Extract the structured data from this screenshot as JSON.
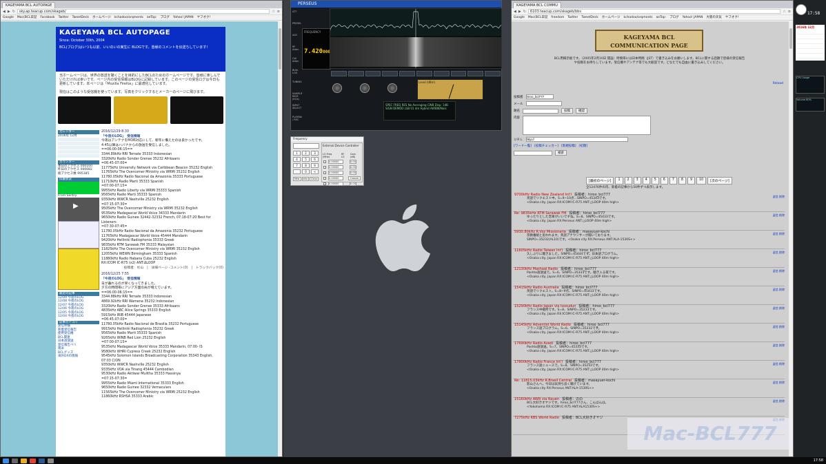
{
  "left_window": {
    "tab_title": "KAGEYAMA BCL AUTOPAGE",
    "url": "sky.ap.teacup.com/skageb/",
    "bookmarks": [
      "Google",
      "Mac(BCL日記",
      "Facebook",
      "Twitter",
      "TweetDeck",
      "ホームページ",
      "kchadoo/orqments",
      "aeTop:",
      "ブログ",
      "Yahoo! JAPAN",
      "ヤフオク!"
    ],
    "site_title": "KAGEYAMA BCL AUTOPAGE",
    "since": "Since: October 30th, 2004",
    "tagline": "BCL(ブログ)はいつも以前、いいのいの実生に BLOGです。皆様のコメントを伝送ちしています！",
    "intro": "当ホームページは、世界の放送を聴くことを目的にしたBCLのためのホームページです。皆様に楽しんでいただければ幸いです。ページ内の受信情報はBLOGに記録しています。このページの受信ログは今日も更新しています。本ページは「Mozilla Firefox」に最適化しています。",
    "radio_caption": "現在はこのような受信機を使っています。写真をクリックするとメーカーのページに飛びます。",
    "sidebar": {
      "calendar_title": "カレンダー",
      "calendar_month": "2016年 12月",
      "counter_title": "カウンター",
      "counter_lines": [
        "本日のアクセス 000160",
        "昨日のアクセス 000082",
        "総アクセス数 995385"
      ],
      "prop_title": "伝搬状況",
      "solar_title": "From:Sentry",
      "recent_title": "最近の記事",
      "recent_items": [
        "12/09 今夜のLOG",
        "12/08 今夜のLOG",
        "12/07 今夜のLOG",
        "12/06 今夜のLOG",
        "12/05 今夜のLOG",
        "12/04 今夜のLOG"
      ],
      "archive_title": "記事カテゴリ",
      "archive_items": [
        "受信体験",
        "新着受信報告",
        "使用受信機",
        "BCL関連",
        "日本語放送",
        "受信報告ベリ",
        "南米",
        "BCLグッズ",
        "海外DXの情報"
      ]
    },
    "posts": [
      {
        "date": "2016/12/29  8:33",
        "title": "「今夜のLOG」　受信情報",
        "lines": [
          "今夜はアンテナをMOR対応にして、新年に備えたのは良かったです。",
          "4:45以降はハバナからの放送を受信しました。",
          "==06:00-06:15==",
          "3344.89kHz RRI Ternate 35333 Indonesian",
          "3320kHz Radio Sonder Grense 35232 Afrikaans",
          "=06:45-07:00=",
          "11775kHz University Network via Caribbean Beacon 35232 English",
          "11765kHz The Overcomer Ministry via WRMI 35232 English",
          "11780.05kHz Radio Nacional da Amazonia 35333 Portuguese",
          "11710kHz Radio Marti 35333 Spanish",
          "=07:00-07:15=",
          "9955kHz Radio Liberty via WRMI 35333 Spanish",
          "9565kHz Radio Marti 35333 Spanish",
          "9350kHz WWCR Nashville 25232 English",
          "=07:15-07:30=",
          "9505kHz The Overcomer Ministry via WRMI 35232 English",
          "9535kHz Madagascar World Voice 34333 Mandarin",
          "9650kHz Radio Guinee 32442-32332 French, 07:18-07:20 Best for Listeners",
          "=07:30-07:45=",
          "11780.05kHz Radio Nacional da Amazonia 35232 Portuguese",
          "11765kHz Madagascar World Voice 45444 Mandarin",
          "9420kHz Hellinikí Radiophonia 35333 Greek",
          "9835kHz RTM Sarawak FM 35333 Malaysian",
          "11825kHz The Overcomer Ministry via WRMI 35232 English",
          "12055kHz WEWN Birmingham 35333 Spanish",
          "11880kHz Radio Habana Cuba 25232 English",
          "RX:ICOM IC-R75 (x2) ANT:ΔLOOP"
        ],
        "footer": "投稿者：杉山　|　詳細ページ -コメント(0)　|　トラックバック(0)"
      },
      {
        "date": "2016/12/25  7:55",
        "title": "「今夜のLOG」　受信情報",
        "lines": [
          "日が暮れるのが早くなってきました。",
          "夕方の時間帯にアジア方面の局が増えています。",
          "==06:00-06:15==",
          "3344.88kHz RRI Ternate 35333 Indonesian",
          "4869.92kHz RRI Wamena 35232 Indonesian",
          "3320kHz Radio Sonder Grense 35333 Afrikaans",
          "4835kHz ABC Alice Springs 35333 English",
          "5915kHz IRIB 45444 Japanese",
          "=06:45-07:00=",
          "11780.05kHz Radio Nacional de Brasilia 35232 Portuguese",
          "9915kHz Hellinikí Radiophonia 35232 Greek",
          "9565kHz Radio Marti 35333 Spanish",
          "9265kHz WINB Red Lion 25232 English",
          "=07:00-07:15=",
          "9535kHz Madagascar World Voice 35333 Mandarin, 07:00- IS",
          "9580kHz WHRI Cypress Creek 25232 English",
          "9545kHz Solomon Islands Broadcasting Corporation 35343 English, 07:03 C/ON",
          "9350kHz WWCR Nashville 25232 English",
          "9335kHz VOA via Tinang 45444 Cambodian",
          "9530kHz Radio Aktiwar Mulitha 35333 Hassinya",
          "=07:15-07:30=",
          "9955kHz Radio Miami International 35333 English",
          "9650kHz Radio Guinee 32332 Vernaculars",
          "11565kHz The Overcomer Ministry via WRMI 25232 English",
          "11860kHz RSHSA 35333 Arabic"
        ]
      }
    ]
  },
  "perseus": {
    "title": "PERSEUS",
    "frequency": "7.420",
    "frequency_small": "000",
    "freq_label": "FREQUENCY",
    "info_lines": [
      "SPEC FREQ RES No Averaging  CWB Disp: 1dB",
      "SIGN DEMOD LSB 01 4m Hybrid AtRBW/Nois"
    ],
    "meter_label": "Level (dBm)",
    "side_labels": [
      "ATT",
      "PRESEL",
      "AGC",
      "RF Atten",
      "CW Atten",
      "BUN-LOG",
      "TUNING",
      "SAMPLING RATE (kS/s)",
      "INPUT SELECT",
      "PLAYBACK / REC"
    ]
  },
  "ext_dialog": {
    "title": "External Device Controller",
    "left_title": "Frequency",
    "keys": [
      "1",
      "2",
      "3",
      "4",
      "5",
      "6",
      "7",
      "8",
      "9",
      ".",
      "0",
      "<"
    ],
    "bottom_keys": [
      "MHz",
      "kHz",
      "Clear"
    ],
    "headers": [
      "LO Freq (MHz)",
      "RF LO",
      "Gain (dB)"
    ],
    "rows": [
      "0.00000",
      "0.00000",
      "0.00000",
      "0.00000",
      "0.00000"
    ],
    "gain": [
      "0.00",
      "0.00",
      "0.00",
      "0.00",
      "0.00"
    ],
    "cancel": "Cancel"
  },
  "right_window": {
    "tab_title": "KAGEYAMA BCL COMMU",
    "url": "6103.teacup.com/skageb/bbs",
    "bookmarks": [
      "Google",
      "Mac(BCL日記",
      "freedom",
      "Twitter",
      "TweetDeck",
      "ホームページ",
      "kchadoo/orqments",
      "aeTop:",
      "ブログ",
      "Yahoo! JAPAN",
      "大阪の天気",
      "ヤフオク!"
    ],
    "site_title_1": "KAGEYAMA BCL",
    "site_title_2": "COMMUNICATION PAGE",
    "intro": "BCL用掲示板です。（2005年2月10日 開設）時間帯には日本時間（JST）で書き込みをお願いします。BCLに関する話題で皆様の受信報告や投稿をお待ちしています。受信機やアンテナ等でも大歓迎です。どなたでも自由に書き込みしてください。",
    "reload": "Reload",
    "form": {
      "name_label": "投稿者",
      "name_value": "hiroo_bcl777",
      "mail_label": "メール",
      "title_label": "題名",
      "content_label": "内容",
      "url_label": "ＵＲＬ",
      "url_value": "http://",
      "send_button": "投稿",
      "confirm_button": "確認",
      "search_button": "検索",
      "links": [
        "[ワード一覧]",
        "[投稿チェッカー]",
        "[新規投稿]",
        "[初期]"
      ]
    },
    "pages": [
      "[最初のページ]",
      "1",
      "2",
      "3",
      "4",
      "5",
      "6",
      "7",
      "8",
      "9",
      "10",
      "[次のページ]"
    ],
    "total": "全12476件の内、新着の記事から50件ずつ表示します。",
    "posts": [
      {
        "title": "9700kHz Radio New Zealand Int'l",
        "by": "投稿者：hiroo_bcl777",
        "body1": "英語でリクエスト中。S=9~10点…SINPO=45343です。",
        "body2": "<Osaka city, Japan RX:ICOM IC-R75 ANT:△LOOP 40m high>"
      },
      {
        "title": "Re: 9835kHz RTM Sarawak FM",
        "by": "投稿者：hiroo_bcl777",
        "body1": "ゆったりとした音楽がいいですね。S=8、SINPO=45433です。",
        "body2": "<Osaka city, Japan RX:Perseus ANT:△LOOP 40m high>"
      },
      {
        "title": "5930.80kHz R.Voz Missionaria",
        "by": "投稿者：masayuer-kochi",
        "body1": "宗教番組と思われます。英語アナウンサーが聞いております。",
        "body2": "SINPO=35232(AL10)です。<Osaka city RX:Perseus ANT:ALA-1530S+>"
      },
      {
        "title": "11605kHz Radio Taiwan Int'l",
        "by": "投稿者：hiroo_bcl777",
        "body1": "久しぶりに聴きました。SINPO=45444です。日本語プログラム。",
        "body2": "<Osaka city, Japan RX:ICOM IC-R75 ANT:△LOOP 40m high>"
      },
      {
        "title": "12130kHz Mashaal Radio",
        "by": "投稿者：hiroo_bcl777",
        "body1": "Pashto語放送で。S=6、SINPO=35333です。聴き入る夜です。",
        "body2": "<Osaka city, Japan RX:ICOM IC-R75 ANT:△LOOP 40m high>"
      },
      {
        "title": "15415kHz Radio Australia",
        "by": "投稿者：hiroo_bcl777",
        "body1": "英語でリクエスト。S=8~9点、SINPO=45433です。",
        "body2": "<Osaka city, Japan RX:ICOM IC-R75 ANT:△LOOP 40m high>"
      },
      {
        "title": "15290kHz Radio Japan via Issoudun",
        "by": "投稿者：hiroo_bcl777",
        "body1": "フランス中継所です。S=8、SINPO=35233です。",
        "body2": "<Osaka city, Japan RX:ICOM IC-R75 ANT:△LOOP 40m high>"
      },
      {
        "title": "15145kHz Adventist World Radio",
        "by": "投稿者：hiroo_bcl777",
        "body1": "フランス語プログラム。S=6、SINPO=35232です。",
        "body2": "<Osaka city, Japan RX:ICOM IC-R75 ANT:△LOOP 40m high>"
      },
      {
        "title": "17690kHz Radio Azadi",
        "by": "投稿者：hiroo_bcl777",
        "body1": "Pashto語放送。S=7、SINPO=45333です。",
        "body2": "<Osaka city, Japan RX:ICOM IC-R75 ANT:△LOOP 40m high>"
      },
      {
        "title": "17800kHz Radio France Int'l",
        "by": "投稿者：hiroo_bcl777",
        "body1": "フランス語ニュースで。S=8、SINPO=35233です。",
        "body2": "<Osaka city, Japan RX:ICOM IC-R75 ANT:△LOOP 40m high>"
      },
      {
        "title": "Re: 11815.03kHz R.Brasil Central",
        "by": "投稿者：masayuer-kochi",
        "body1": "影山さんへ。今日は気持ち良く聴けています。",
        "body2": "<Osaka city RX:Perseus ANT:ALA-1530S+>"
      },
      {
        "title": "15160kHz AWR via Nauen",
        "by": "投稿者：のの",
        "body1": "BCL大好きオヤジです。hiroo_bcl777さん、こんばんは。",
        "body2": "<Yokohama RX:ICOM IC-R75 ANT:ALA1530S+>"
      },
      {
        "title": "7275kHz KBS World Radio",
        "by": "投稿者：BCL大好きオヤジ",
        "body1": "",
        "body2": ""
      }
    ],
    "post_link": "返信 削除"
  },
  "watermark": "Mac-BCL777",
  "widgets": {
    "time": "17:58",
    "calendar_header": "2016年 12月",
    "cpu_label": "CPU Usage",
    "vol_label": "Volume 80%"
  },
  "taskbar": {
    "clock": "17:58"
  }
}
